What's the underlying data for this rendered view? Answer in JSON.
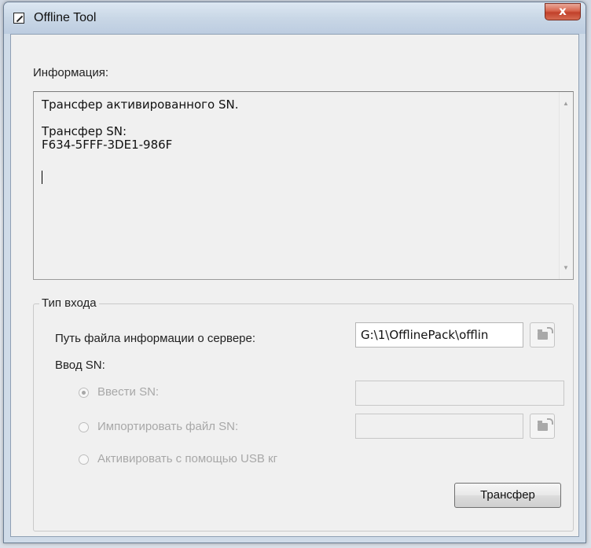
{
  "window": {
    "title": "Offline Tool",
    "close_label": "x"
  },
  "info": {
    "label": "Информация:",
    "text": "Трансфер активированного SN.\n\nТрансфер SN:\nF634-5FFF-3DE1-986F"
  },
  "login_type": {
    "group_title": "Тип входа",
    "server_path_label": "Путь файла информации о сервере:",
    "server_path_value": "G:\\1\\OfflinePack\\offlin",
    "sn_input_label": "Ввод SN:",
    "options": [
      {
        "label": "Ввести SN:",
        "selected": true,
        "enabled": false
      },
      {
        "label": "Импортировать файл SN:",
        "selected": false,
        "enabled": false
      },
      {
        "label": "Активировать с помощью USB кг",
        "selected": false,
        "enabled": false
      }
    ],
    "enter_sn_value": "",
    "import_sn_value": ""
  },
  "buttons": {
    "transfer": "Трансфер"
  },
  "colors": {
    "title_close": "#c1402a",
    "window_frame": "#cfdbe8",
    "disabled_text": "#a8a8a8"
  },
  "icons": [
    "app-icon",
    "close-icon",
    "folder-open-icon",
    "scroll-up-icon",
    "scroll-down-icon"
  ]
}
